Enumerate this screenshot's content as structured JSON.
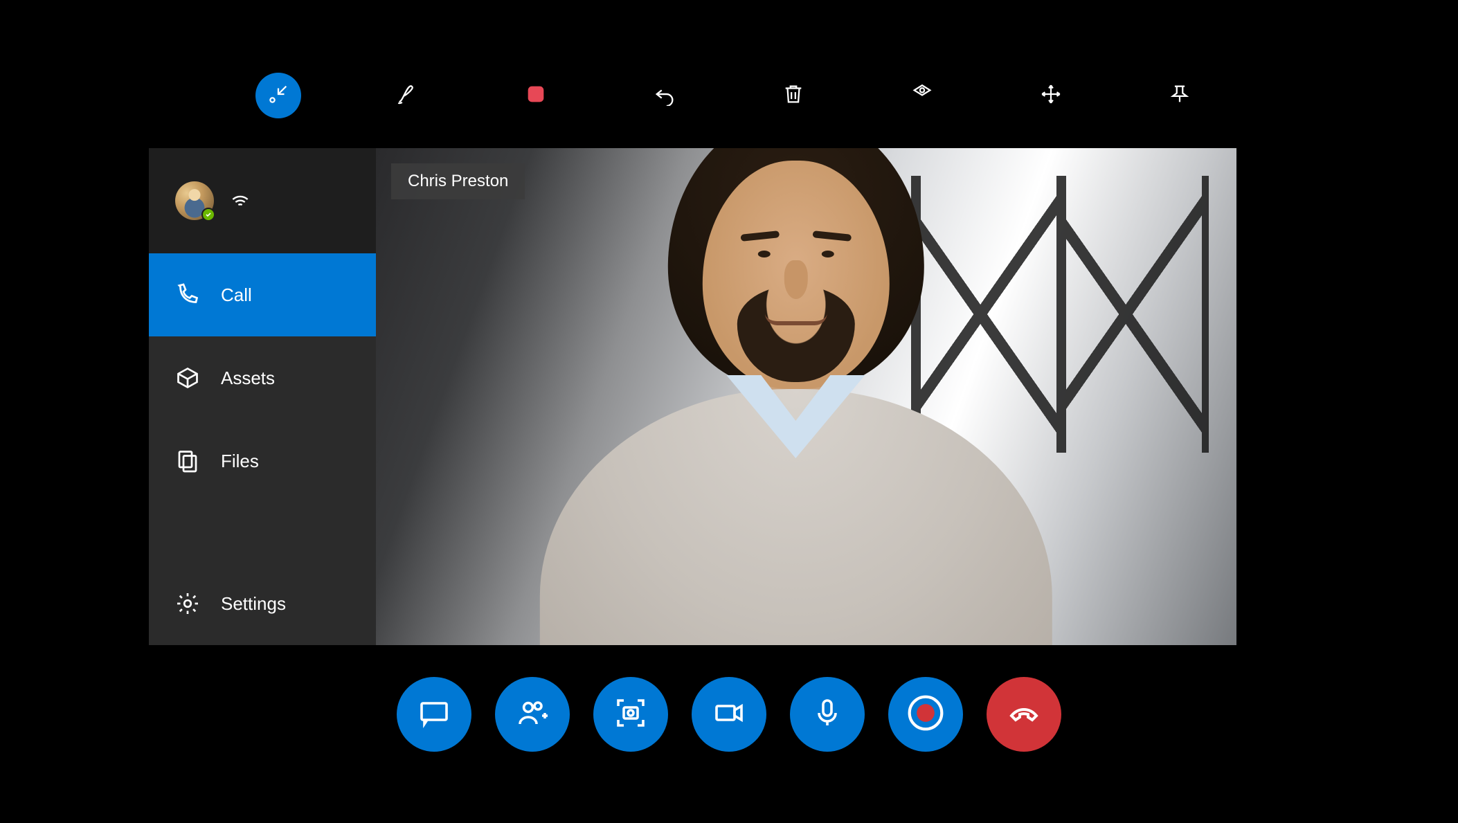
{
  "toolbar": {
    "collapse": "collapse",
    "ink": "ink",
    "stop": "stop",
    "undo": "undo",
    "delete": "delete",
    "spatial": "spatial",
    "move": "move",
    "pin": "pin"
  },
  "sidebar": {
    "items": [
      {
        "label": "Call"
      },
      {
        "label": "Assets"
      },
      {
        "label": "Files"
      },
      {
        "label": "Settings"
      }
    ]
  },
  "video": {
    "participant_name": "Chris Preston"
  },
  "controls": {
    "chat": "chat",
    "add_participant": "add participant",
    "screenshot": "screenshot",
    "video": "video",
    "mic": "microphone",
    "record": "record",
    "end_call": "end call"
  },
  "colors": {
    "accent": "#0078D4",
    "danger": "#D13438",
    "presence": "#6BB700"
  }
}
